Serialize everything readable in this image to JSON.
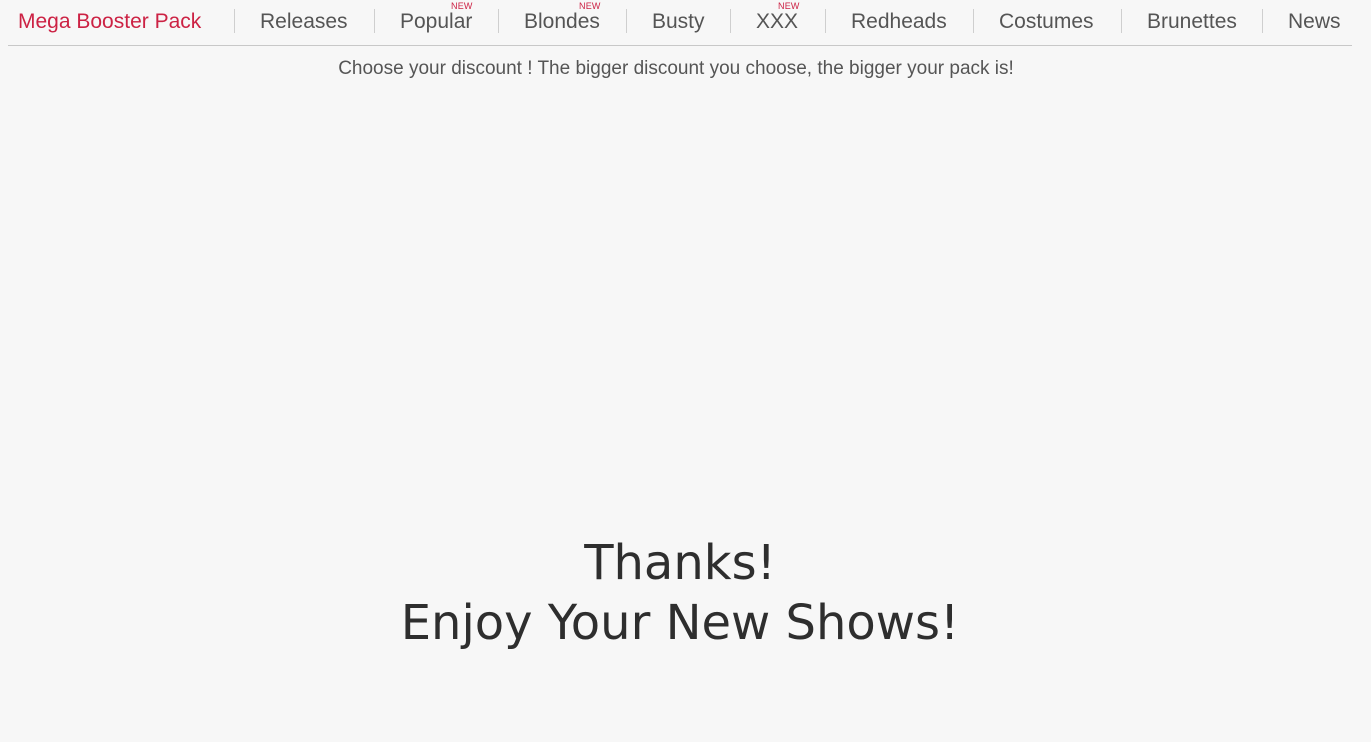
{
  "nav": {
    "brand": "Mega Booster Pack",
    "items": [
      {
        "label": "Releases"
      },
      {
        "label": "Popular",
        "badge": "NEW"
      },
      {
        "label": "Blondes",
        "badge": "NEW"
      },
      {
        "label": "Busty"
      },
      {
        "label": "XXX",
        "badge": "NEW"
      },
      {
        "label": "Redheads"
      },
      {
        "label": "Costumes"
      },
      {
        "label": "Brunettes"
      },
      {
        "label": "News"
      }
    ]
  },
  "tagline": "Choose your discount ! The bigger discount you choose, the bigger your pack is!",
  "message": {
    "line1": "Thanks!",
    "line2": "Enjoy Your New Shows!"
  },
  "colors": {
    "accent": "#cc2244",
    "text": "#555555",
    "heading": "#2e2e2e",
    "background": "#f7f7f7"
  }
}
